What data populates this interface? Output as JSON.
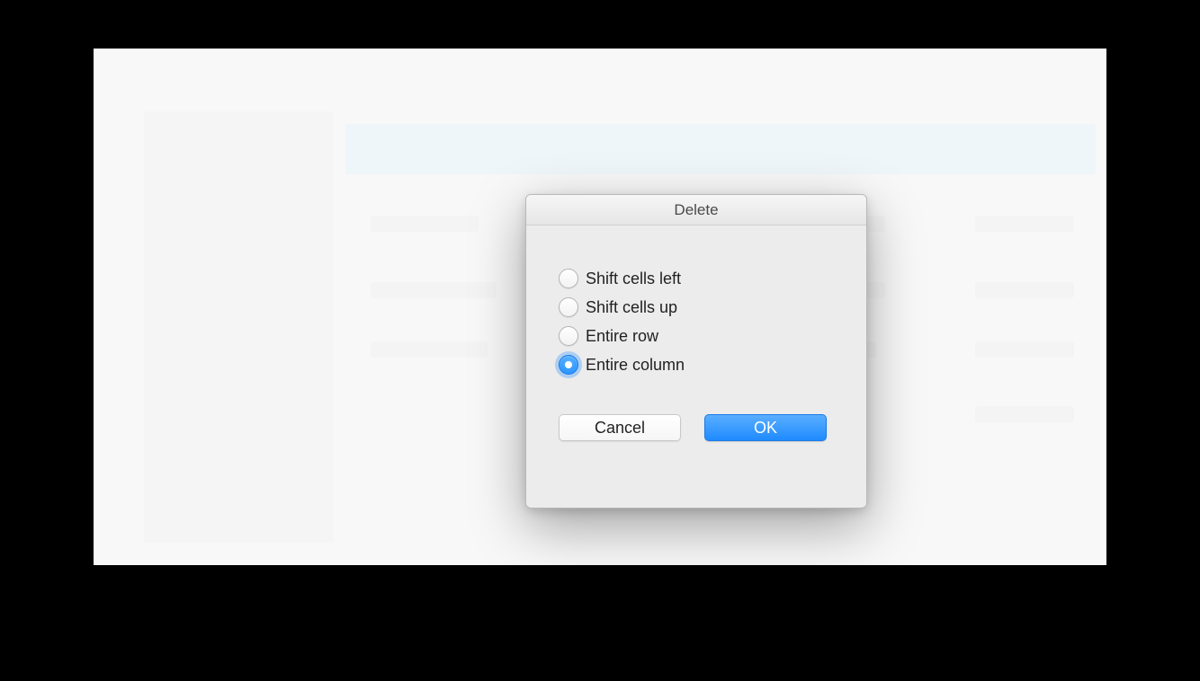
{
  "dialog": {
    "title": "Delete",
    "options": [
      {
        "label": "Shift cells left",
        "selected": false
      },
      {
        "label": "Shift cells up",
        "selected": false
      },
      {
        "label": "Entire row",
        "selected": false
      },
      {
        "label": "Entire column",
        "selected": true
      }
    ],
    "cancel_label": "Cancel",
    "ok_label": "OK"
  }
}
